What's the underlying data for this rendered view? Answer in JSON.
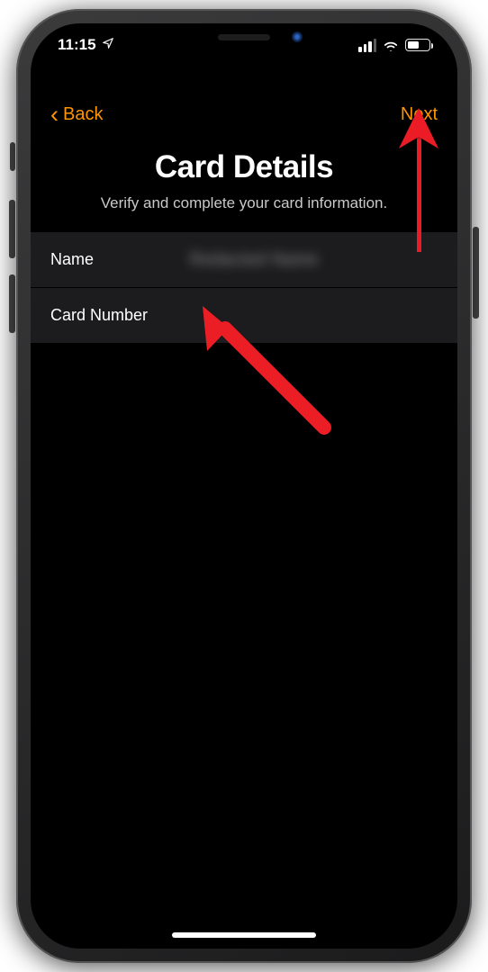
{
  "status_bar": {
    "time": "11:15"
  },
  "nav": {
    "back_label": "Back",
    "next_label": "Next"
  },
  "header": {
    "title": "Card Details",
    "subtitle": "Verify and complete your card information."
  },
  "form": {
    "name": {
      "label": "Name",
      "value": "Redacted Name"
    },
    "card_number": {
      "label": "Card Number",
      "value": ""
    }
  },
  "colors": {
    "accent": "#ff9500"
  }
}
